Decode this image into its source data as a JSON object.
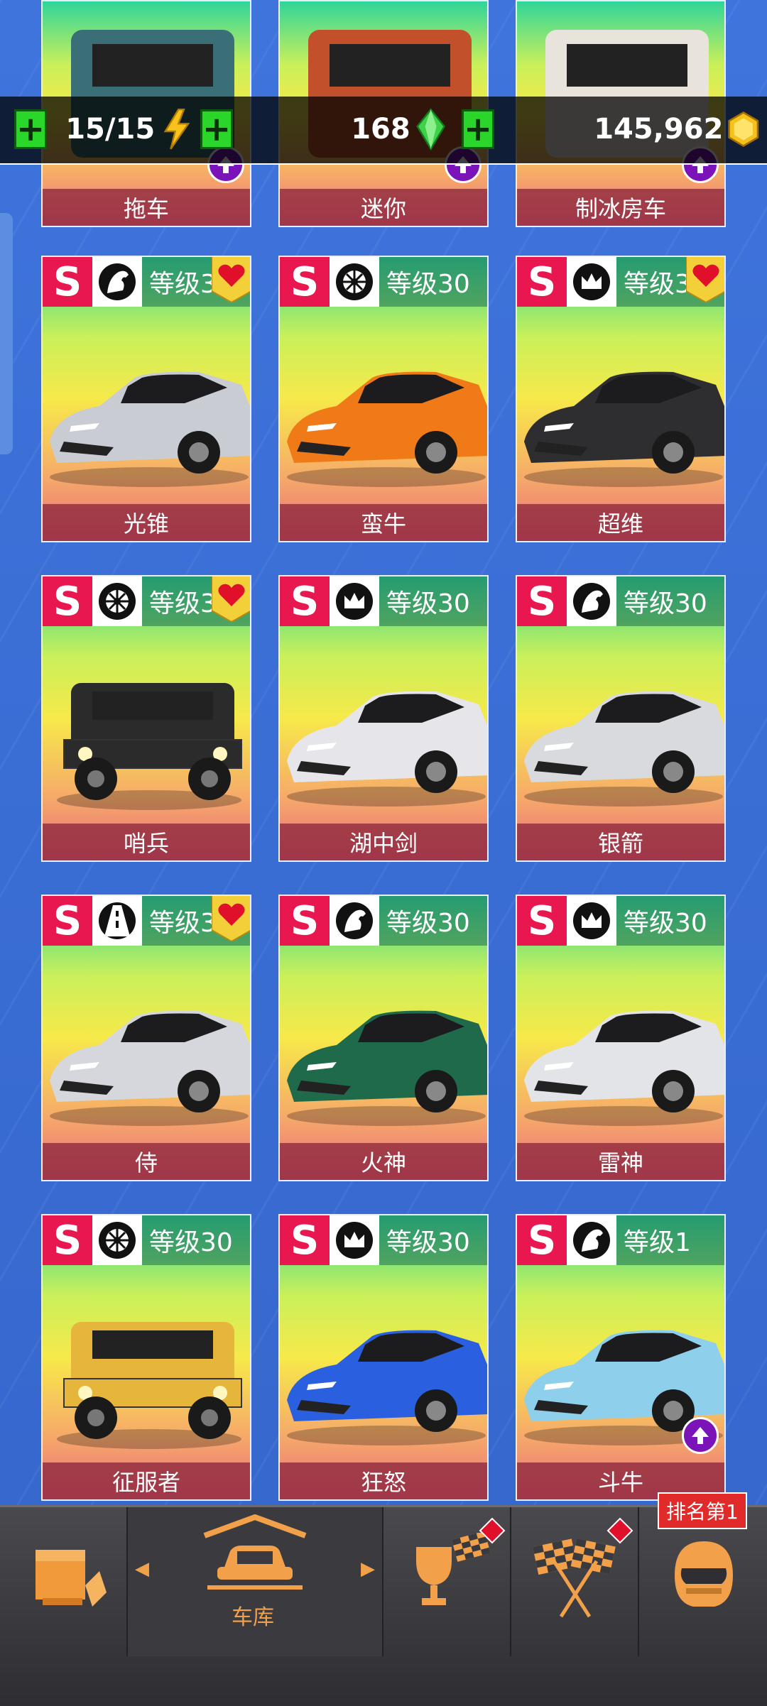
{
  "resources": {
    "energy": {
      "value": "15/15",
      "icon": "lightning-icon"
    },
    "gems": {
      "value": "168",
      "icon": "gem-icon"
    },
    "coins": {
      "value": "145,962",
      "icon": "coin-icon"
    }
  },
  "top_cars": [
    {
      "name": "拖车"
    },
    {
      "name": "迷你"
    },
    {
      "name": "制冰房车"
    }
  ],
  "cars": [
    {
      "name": "光锥",
      "rank": "S",
      "brand": "horse-icon",
      "level": "等级3",
      "favorite": true,
      "color": "#c9ccd2"
    },
    {
      "name": "蛮牛",
      "rank": "S",
      "brand": "wheel-icon",
      "level": "等级30",
      "favorite": false,
      "color": "#f07a18"
    },
    {
      "name": "超维",
      "rank": "S",
      "brand": "crown-icon",
      "level": "等级3",
      "favorite": true,
      "color": "#2e2e30"
    },
    {
      "name": "哨兵",
      "rank": "S",
      "brand": "wheel-icon",
      "level": "等级3",
      "favorite": true,
      "color": "#2b2b2b"
    },
    {
      "name": "湖中剑",
      "rank": "S",
      "brand": "crown-icon",
      "level": "等级30",
      "favorite": false,
      "color": "#e6e6ea"
    },
    {
      "name": "银箭",
      "rank": "S",
      "brand": "horse-icon",
      "level": "等级30",
      "favorite": false,
      "color": "#d8dadd"
    },
    {
      "name": "侍",
      "rank": "S",
      "brand": "road-icon",
      "level": "等级3",
      "favorite": true,
      "color": "#d5d7dc"
    },
    {
      "name": "火神",
      "rank": "S",
      "brand": "horse-icon",
      "level": "等级30",
      "favorite": false,
      "color": "#1f6a4a"
    },
    {
      "name": "雷神",
      "rank": "S",
      "brand": "crown-icon",
      "level": "等级30",
      "favorite": false,
      "color": "#e2e4e8"
    },
    {
      "name": "征服者",
      "rank": "S",
      "brand": "wheel-icon",
      "level": "等级30",
      "favorite": false,
      "color": "#e6b63c"
    },
    {
      "name": "狂怒",
      "rank": "S",
      "brand": "crown-icon",
      "level": "等级30",
      "favorite": false,
      "color": "#2a5fe0"
    },
    {
      "name": "斗牛",
      "rank": "S",
      "brand": "horse-icon",
      "level": "等级1",
      "favorite": false,
      "color": "#8ed0ec"
    }
  ],
  "nav": {
    "garage_label": "车库",
    "rank_tag": "排名第1"
  }
}
